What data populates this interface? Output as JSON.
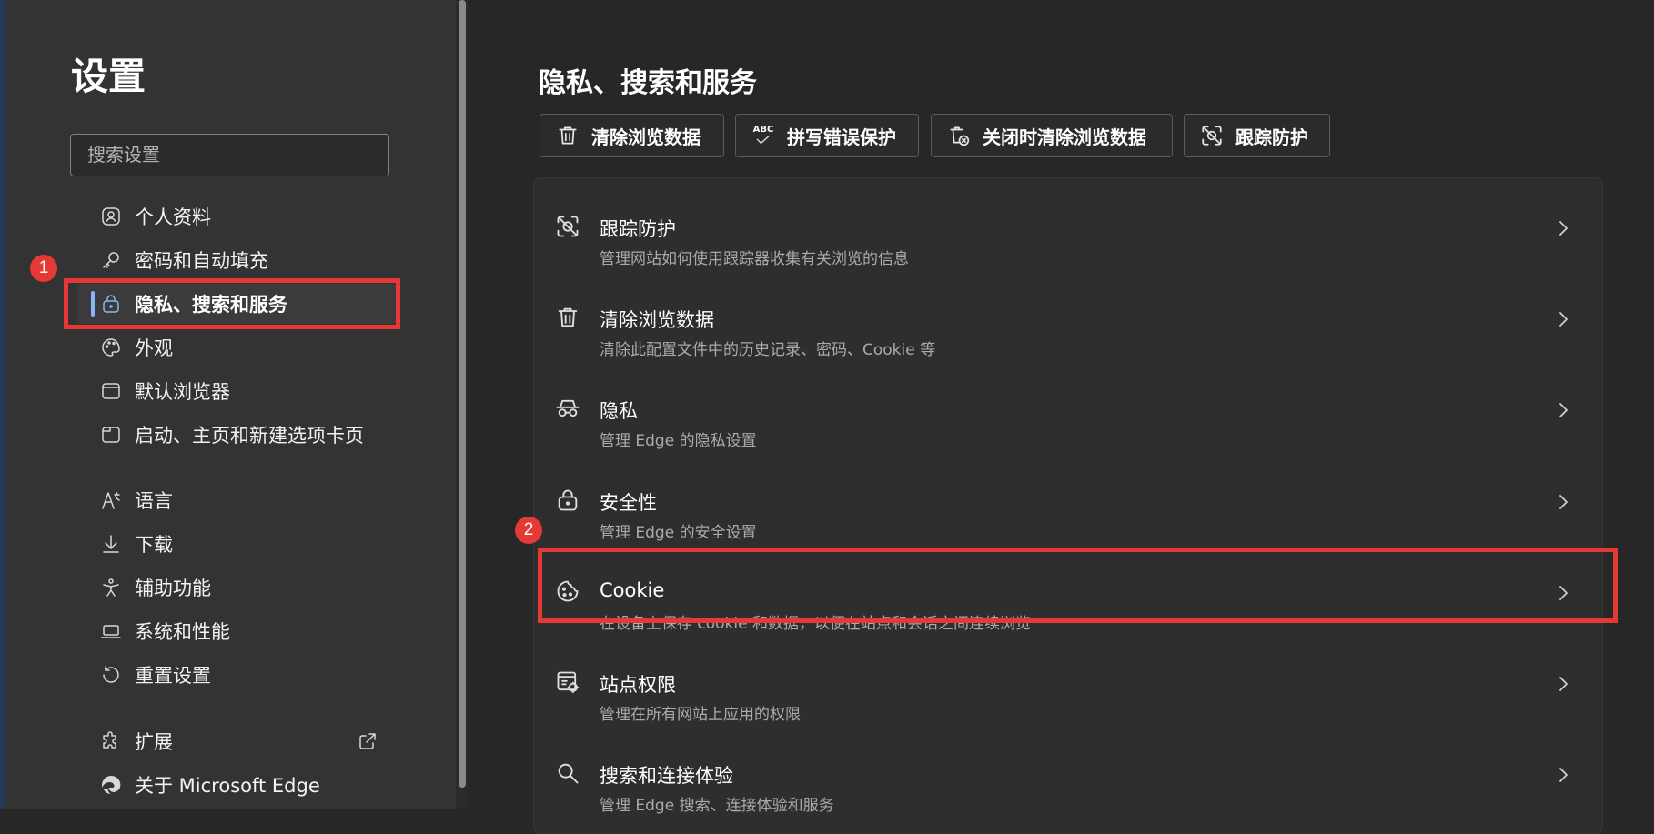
{
  "sidebar": {
    "title": "设置",
    "search_placeholder": "搜索设置",
    "items": [
      {
        "label": "个人资料",
        "icon": "profile-icon"
      },
      {
        "label": "密码和自动填充",
        "icon": "key-icon"
      },
      {
        "label": "隐私、搜索和服务",
        "icon": "lock-icon",
        "selected": true
      },
      {
        "label": "外观",
        "icon": "palette-icon"
      },
      {
        "label": "默认浏览器",
        "icon": "browser-window-icon"
      },
      {
        "label": "启动、主页和新建选项卡页",
        "icon": "tab-page-icon"
      },
      {
        "label": "语言",
        "icon": "language-icon"
      },
      {
        "label": "下载",
        "icon": "download-icon"
      },
      {
        "label": "辅助功能",
        "icon": "accessibility-icon"
      },
      {
        "label": "系统和性能",
        "icon": "laptop-icon"
      },
      {
        "label": "重置设置",
        "icon": "reset-icon"
      },
      {
        "label": "扩展",
        "icon": "extension-icon"
      },
      {
        "label": "关于 Microsoft Edge",
        "icon": "edge-logo-icon"
      }
    ]
  },
  "main": {
    "title": "隐私、搜索和服务",
    "quick_buttons": [
      {
        "label": "清除浏览数据",
        "icon": "trash-icon"
      },
      {
        "label": "拼写错误保护",
        "icon": "spellcheck-icon",
        "icon_text": "ABC"
      },
      {
        "label": "关闭时清除浏览数据",
        "icon": "trash-clear-icon"
      },
      {
        "label": "跟踪防护",
        "icon": "tracking-prevention-icon"
      }
    ],
    "rows": [
      {
        "title": "跟踪防护",
        "desc": "管理网站如何使用跟踪器收集有关浏览的信息",
        "icon": "tracking-prevention-icon"
      },
      {
        "title": "清除浏览数据",
        "desc": "清除此配置文件中的历史记录、密码、Cookie 等",
        "icon": "trash-icon"
      },
      {
        "title": "隐私",
        "desc": "管理 Edge 的隐私设置",
        "icon": "incognito-glasses-icon"
      },
      {
        "title": "安全性",
        "desc": "管理 Edge 的安全设置",
        "icon": "lock-icon"
      },
      {
        "title": "Cookie",
        "desc": "在设备上保存 cookie 和数据，以便在站点和会话之间连续浏览",
        "icon": "cookie-icon"
      },
      {
        "title": "站点权限",
        "desc": "管理在所有网站上应用的权限",
        "icon": "site-permissions-icon"
      },
      {
        "title": "搜索和连接体验",
        "desc": "管理 Edge 搜索、连接体验和服务",
        "icon": "search-icon"
      }
    ]
  },
  "annotations": {
    "badge_1": "1",
    "badge_2": "2",
    "color": "#e53935"
  },
  "colors": {
    "accent": "#8ab4f8",
    "background": "#272727",
    "sidebar": "#333333"
  }
}
